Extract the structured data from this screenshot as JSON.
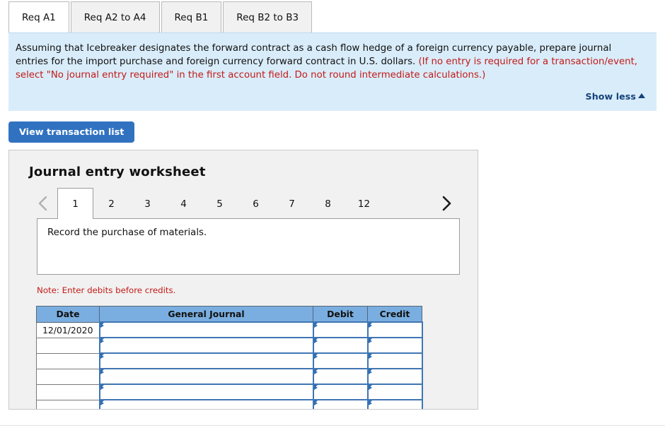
{
  "req_tabs": [
    {
      "label": "Req A1",
      "active": true
    },
    {
      "label": "Req A2 to A4",
      "active": false
    },
    {
      "label": "Req B1",
      "active": false
    },
    {
      "label": "Req B2 to B3",
      "active": false
    }
  ],
  "instructions": {
    "black_part_1": "Assuming that Icebreaker designates the forward contract as a cash flow hedge of a foreign currency payable, prepare journal entries for the import purchase and foreign currency forward contract in U.S. dollars.",
    "red_part": "(If no entry is required for a transaction/event, select \"No journal entry required\" in the first account field. Do not round intermediate calculations.)",
    "show_less_label": "Show less",
    "background_color": "#d9ecfa",
    "red_color": "#c21b17"
  },
  "toolbar": {
    "view_transaction_list_label": "View transaction list",
    "button_color": "#3172c0"
  },
  "worksheet": {
    "title": "Journal entry worksheet",
    "pager": {
      "prev_label": "‹",
      "next_label": "›",
      "pages": [
        {
          "label": "1",
          "active": true
        },
        {
          "label": "2",
          "active": false
        },
        {
          "label": "3",
          "active": false
        },
        {
          "label": "4",
          "active": false
        },
        {
          "label": "5",
          "active": false
        },
        {
          "label": "6",
          "active": false
        },
        {
          "label": "7",
          "active": false
        },
        {
          "label": "8",
          "active": false
        },
        {
          "label": "12",
          "active": false
        }
      ]
    },
    "prompt": "Record the purchase of materials.",
    "note": "Note: Enter debits before credits.",
    "table": {
      "header_color": "#7aaee0",
      "columns": [
        "Date",
        "General Journal",
        "Debit",
        "Credit"
      ],
      "rows": [
        {
          "date": "12/01/2020",
          "general_journal": "",
          "debit": "",
          "credit": ""
        },
        {
          "date": "",
          "general_journal": "",
          "debit": "",
          "credit": ""
        },
        {
          "date": "",
          "general_journal": "",
          "debit": "",
          "credit": ""
        },
        {
          "date": "",
          "general_journal": "",
          "debit": "",
          "credit": ""
        },
        {
          "date": "",
          "general_journal": "",
          "debit": "",
          "credit": ""
        },
        {
          "date": "",
          "general_journal": "",
          "debit": "",
          "credit": ""
        }
      ]
    }
  }
}
